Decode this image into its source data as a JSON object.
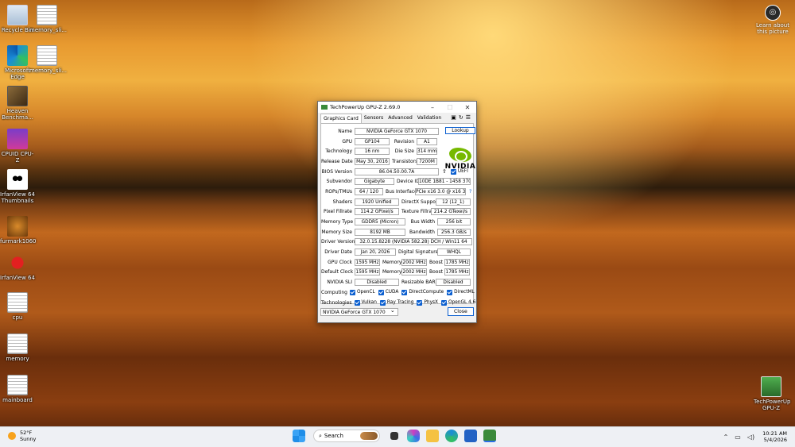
{
  "desktop": {
    "icons_left": [
      {
        "label": "Recycle Bin",
        "icon": "recycle-bin-icon"
      },
      {
        "label": "Microsoft Edge",
        "icon": "edge-icon"
      },
      {
        "label": "Heaven Benchma...",
        "icon": "heaven-icon"
      },
      {
        "label": "CPUID CPU-Z",
        "icon": "cpuz-icon"
      },
      {
        "label": "IrfanView 64 Thumbnails",
        "icon": "panda-icon"
      },
      {
        "label": "furmark1060",
        "icon": "furmark-icon"
      },
      {
        "label": "IrfanView 64",
        "icon": "irfanview-icon"
      },
      {
        "label": "cpu",
        "icon": "document-icon"
      },
      {
        "label": "memory",
        "icon": "document-icon"
      },
      {
        "label": "mainboard",
        "icon": "document-icon"
      }
    ],
    "icons_second_col": [
      {
        "label": "memory_sli...",
        "icon": "document-icon"
      },
      {
        "label": "memory_sli...",
        "icon": "document-icon"
      }
    ],
    "learn_label": "Learn about this picture",
    "gpuz_icon_label": "TechPowerUp GPU-Z"
  },
  "window": {
    "title": "TechPowerUp GPU-Z 2.69.0",
    "tabs": [
      "Graphics Card",
      "Sensors",
      "Advanced",
      "Validation"
    ],
    "lookup": "Lookup",
    "nvidia_word": "NVIDIA",
    "fields": {
      "name_label": "Name",
      "name": "NVIDIA GeForce GTX 1070",
      "gpu_label": "GPU",
      "gpu": "GP104",
      "revision_label": "Revision",
      "revision": "A1",
      "tech_label": "Technology",
      "tech": "16 nm",
      "die_label": "Die Size",
      "die": "314 mm²",
      "release_label": "Release Date",
      "release": "May 30, 2016",
      "trans_label": "Transistors",
      "trans": "7200M",
      "bios_label": "BIOS Version",
      "bios": "86.04.50.00.7A",
      "uefi": "UEFI",
      "subvendor_label": "Subvendor",
      "subvendor": "Gigabyte",
      "device_label": "Device ID",
      "device": "10DE 1B81 - 1458 3701",
      "rops_label": "ROPs/TMUs",
      "rops": "64 / 120",
      "bus_label": "Bus Interface",
      "bus": "PCIe x16 3.0 @ x16 3.0",
      "help": "?",
      "shaders_label": "Shaders",
      "shaders": "1920 Unified",
      "dx_label": "DirectX Support",
      "dx": "12 (12_1)",
      "pixel_label": "Pixel Fillrate",
      "pixel": "114.2 GPixel/s",
      "texture_label": "Texture Fillrate",
      "texture": "214.2 GTexel/s",
      "memtype_label": "Memory Type",
      "memtype": "GDDR5 (Micron)",
      "buswidth_label": "Bus Width",
      "buswidth": "256 bit",
      "memsize_label": "Memory Size",
      "memsize": "8192 MB",
      "bandwidth_label": "Bandwidth",
      "bandwidth": "256.3 GB/s",
      "driver_label": "Driver Version",
      "driver": "32.0.15.8228 (NVIDIA 582.28) DCH / Win11 64",
      "driverdate_label": "Driver Date",
      "driverdate": "Jan 20, 2026",
      "sig_label": "Digital Signature",
      "sig": "WHQL",
      "gpuclock_label": "GPU Clock",
      "gpuclock": "1595 MHz",
      "mem_label": "Memory",
      "memclock": "2002 MHz",
      "boost_label": "Boost",
      "boost": "1785 MHz",
      "defclock_label": "Default Clock",
      "defclock": "1595 MHz",
      "defmem": "2002 MHz",
      "defboost": "1785 MHz",
      "sli_label": "NVIDIA SLI",
      "sli": "Disabled",
      "rebar_label": "Resizable BAR",
      "rebar": "Disabled",
      "computing_label": "Computing",
      "technologies_label": "Technologies"
    },
    "computing": [
      "OpenCL",
      "CUDA",
      "DirectCompute",
      "DirectML"
    ],
    "technologies": [
      "Vulkan",
      "Ray Tracing",
      "PhysX",
      "OpenGL 4.6"
    ],
    "selected_gpu": "NVIDIA GeForce GTX 1070",
    "close": "Close"
  },
  "taskbar": {
    "temp": "52°F",
    "condition": "Sunny",
    "search_placeholder": "Search",
    "time": "10:21 AM",
    "date": "5/4/2026"
  },
  "colors": {
    "accent": "#0b5fd0",
    "nvidia_green": "#76b900"
  }
}
